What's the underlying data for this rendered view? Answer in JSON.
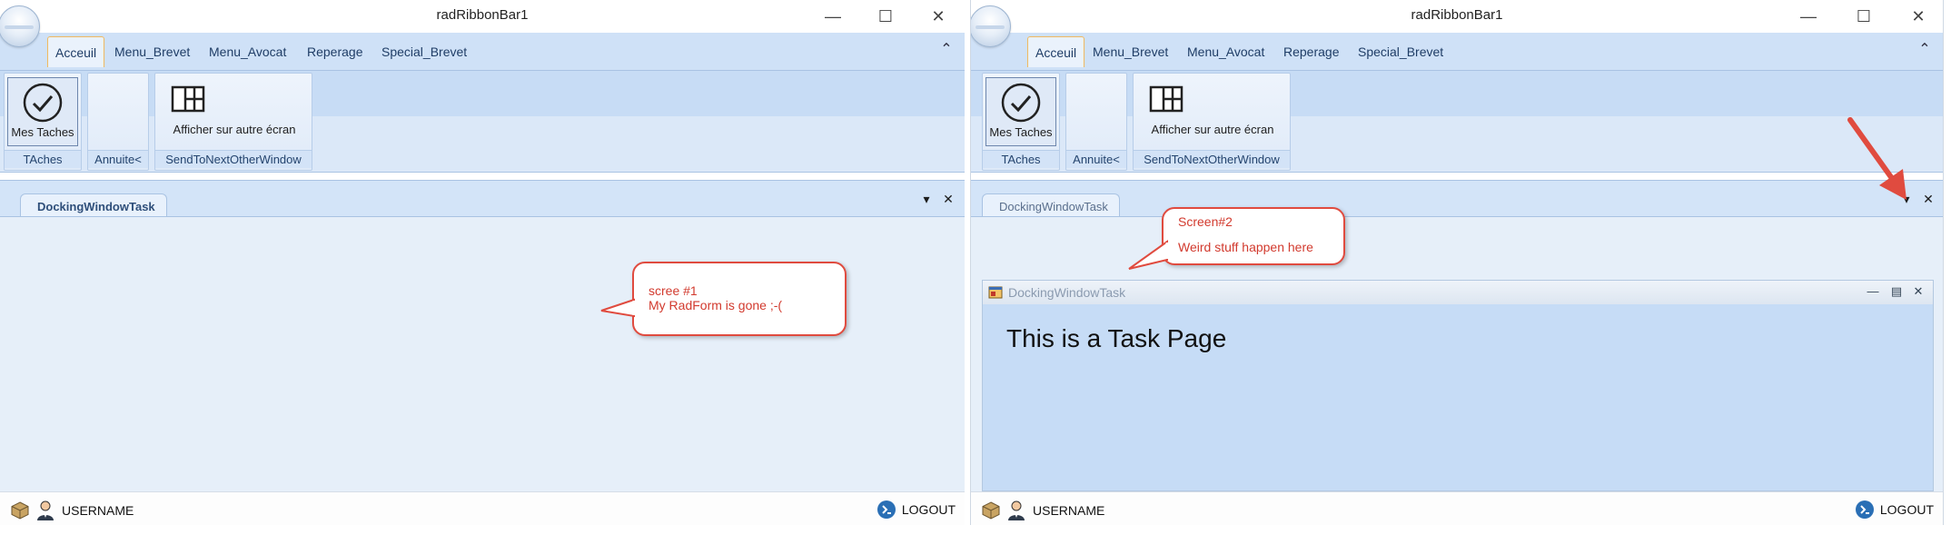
{
  "windows": [
    {
      "title": "radRibbonBar1",
      "ribbon_tabs": [
        "Acceuil",
        "Menu_Brevet",
        "Menu_Avocat",
        "Reperage",
        "Special_Brevet"
      ],
      "groups": [
        {
          "label": "TAches",
          "button_label": "Mes Taches"
        },
        {
          "label": "Annuite<"
        },
        {
          "label": "SendToNextOtherWindow",
          "button_label": "Afficher sur autre écran"
        }
      ],
      "dock_tab": "DockingWindowTask",
      "status": {
        "username": "USERNAME",
        "logout": "LOGOUT"
      },
      "callout": {
        "line1": "scree #1",
        "line2": "My RadForm is gone ;-("
      }
    },
    {
      "title": "radRibbonBar1",
      "ribbon_tabs": [
        "Acceuil",
        "Menu_Brevet",
        "Menu_Avocat",
        "Reperage",
        "Special_Brevet"
      ],
      "groups": [
        {
          "label": "TAches",
          "button_label": "Mes Taches"
        },
        {
          "label": "Annuite<"
        },
        {
          "label": "SendToNextOtherWindow",
          "button_label": "Afficher sur autre écran"
        }
      ],
      "dock_tab": "DockingWindowTask",
      "status": {
        "username": "USERNAME",
        "logout": "LOGOUT"
      },
      "callout": {
        "line1": "Screen#2",
        "line2": "Weird stuff happen here"
      },
      "floating_window": {
        "title": "DockingWindowTask",
        "content": "This is a Task Page"
      }
    }
  ],
  "colors": {
    "accent_tab_border": "#f0b960",
    "ribbon_bg": "#cfe1f7",
    "callout_red": "#e04b3f",
    "inner_content_bg": "#c6dcf6"
  }
}
